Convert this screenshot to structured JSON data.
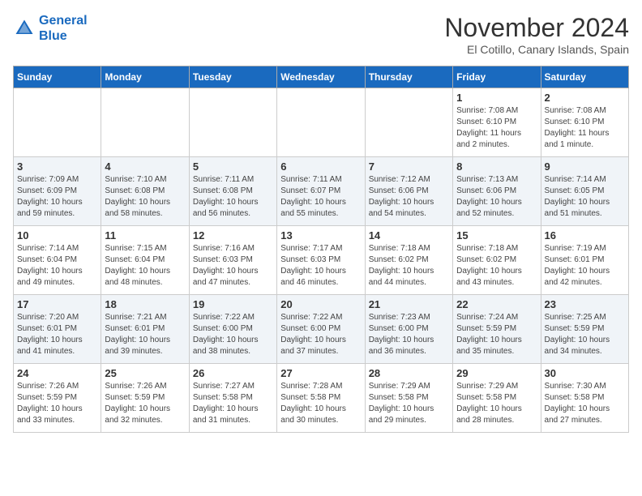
{
  "header": {
    "logo_line1": "General",
    "logo_line2": "Blue",
    "month": "November 2024",
    "location": "El Cotillo, Canary Islands, Spain"
  },
  "weekdays": [
    "Sunday",
    "Monday",
    "Tuesday",
    "Wednesday",
    "Thursday",
    "Friday",
    "Saturday"
  ],
  "weeks": [
    [
      {
        "day": "",
        "info": ""
      },
      {
        "day": "",
        "info": ""
      },
      {
        "day": "",
        "info": ""
      },
      {
        "day": "",
        "info": ""
      },
      {
        "day": "",
        "info": ""
      },
      {
        "day": "1",
        "info": "Sunrise: 7:08 AM\nSunset: 6:10 PM\nDaylight: 11 hours\nand 2 minutes."
      },
      {
        "day": "2",
        "info": "Sunrise: 7:08 AM\nSunset: 6:10 PM\nDaylight: 11 hours\nand 1 minute."
      }
    ],
    [
      {
        "day": "3",
        "info": "Sunrise: 7:09 AM\nSunset: 6:09 PM\nDaylight: 10 hours\nand 59 minutes."
      },
      {
        "day": "4",
        "info": "Sunrise: 7:10 AM\nSunset: 6:08 PM\nDaylight: 10 hours\nand 58 minutes."
      },
      {
        "day": "5",
        "info": "Sunrise: 7:11 AM\nSunset: 6:08 PM\nDaylight: 10 hours\nand 56 minutes."
      },
      {
        "day": "6",
        "info": "Sunrise: 7:11 AM\nSunset: 6:07 PM\nDaylight: 10 hours\nand 55 minutes."
      },
      {
        "day": "7",
        "info": "Sunrise: 7:12 AM\nSunset: 6:06 PM\nDaylight: 10 hours\nand 54 minutes."
      },
      {
        "day": "8",
        "info": "Sunrise: 7:13 AM\nSunset: 6:06 PM\nDaylight: 10 hours\nand 52 minutes."
      },
      {
        "day": "9",
        "info": "Sunrise: 7:14 AM\nSunset: 6:05 PM\nDaylight: 10 hours\nand 51 minutes."
      }
    ],
    [
      {
        "day": "10",
        "info": "Sunrise: 7:14 AM\nSunset: 6:04 PM\nDaylight: 10 hours\nand 49 minutes."
      },
      {
        "day": "11",
        "info": "Sunrise: 7:15 AM\nSunset: 6:04 PM\nDaylight: 10 hours\nand 48 minutes."
      },
      {
        "day": "12",
        "info": "Sunrise: 7:16 AM\nSunset: 6:03 PM\nDaylight: 10 hours\nand 47 minutes."
      },
      {
        "day": "13",
        "info": "Sunrise: 7:17 AM\nSunset: 6:03 PM\nDaylight: 10 hours\nand 46 minutes."
      },
      {
        "day": "14",
        "info": "Sunrise: 7:18 AM\nSunset: 6:02 PM\nDaylight: 10 hours\nand 44 minutes."
      },
      {
        "day": "15",
        "info": "Sunrise: 7:18 AM\nSunset: 6:02 PM\nDaylight: 10 hours\nand 43 minutes."
      },
      {
        "day": "16",
        "info": "Sunrise: 7:19 AM\nSunset: 6:01 PM\nDaylight: 10 hours\nand 42 minutes."
      }
    ],
    [
      {
        "day": "17",
        "info": "Sunrise: 7:20 AM\nSunset: 6:01 PM\nDaylight: 10 hours\nand 41 minutes."
      },
      {
        "day": "18",
        "info": "Sunrise: 7:21 AM\nSunset: 6:01 PM\nDaylight: 10 hours\nand 39 minutes."
      },
      {
        "day": "19",
        "info": "Sunrise: 7:22 AM\nSunset: 6:00 PM\nDaylight: 10 hours\nand 38 minutes."
      },
      {
        "day": "20",
        "info": "Sunrise: 7:22 AM\nSunset: 6:00 PM\nDaylight: 10 hours\nand 37 minutes."
      },
      {
        "day": "21",
        "info": "Sunrise: 7:23 AM\nSunset: 6:00 PM\nDaylight: 10 hours\nand 36 minutes."
      },
      {
        "day": "22",
        "info": "Sunrise: 7:24 AM\nSunset: 5:59 PM\nDaylight: 10 hours\nand 35 minutes."
      },
      {
        "day": "23",
        "info": "Sunrise: 7:25 AM\nSunset: 5:59 PM\nDaylight: 10 hours\nand 34 minutes."
      }
    ],
    [
      {
        "day": "24",
        "info": "Sunrise: 7:26 AM\nSunset: 5:59 PM\nDaylight: 10 hours\nand 33 minutes."
      },
      {
        "day": "25",
        "info": "Sunrise: 7:26 AM\nSunset: 5:59 PM\nDaylight: 10 hours\nand 32 minutes."
      },
      {
        "day": "26",
        "info": "Sunrise: 7:27 AM\nSunset: 5:58 PM\nDaylight: 10 hours\nand 31 minutes."
      },
      {
        "day": "27",
        "info": "Sunrise: 7:28 AM\nSunset: 5:58 PM\nDaylight: 10 hours\nand 30 minutes."
      },
      {
        "day": "28",
        "info": "Sunrise: 7:29 AM\nSunset: 5:58 PM\nDaylight: 10 hours\nand 29 minutes."
      },
      {
        "day": "29",
        "info": "Sunrise: 7:29 AM\nSunset: 5:58 PM\nDaylight: 10 hours\nand 28 minutes."
      },
      {
        "day": "30",
        "info": "Sunrise: 7:30 AM\nSunset: 5:58 PM\nDaylight: 10 hours\nand 27 minutes."
      }
    ]
  ]
}
